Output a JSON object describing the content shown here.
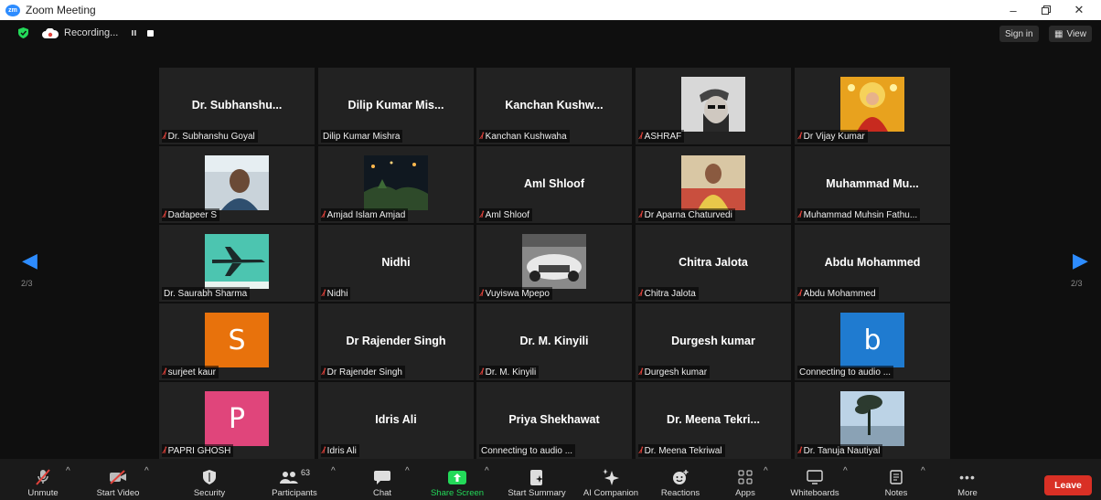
{
  "window": {
    "title": "Zoom Meeting",
    "logo": "zm"
  },
  "topbar": {
    "recording_label": "Recording...",
    "signin_label": "Sign in",
    "view_label": "View"
  },
  "pager": {
    "left_label": "2/3",
    "right_label": "2/3"
  },
  "tiles": [
    {
      "big": "Dr. Subhanshu...",
      "name": "Dr. Subhanshu Goyal",
      "muted": true
    },
    {
      "big": "Dilip Kumar Mis...",
      "name": "Dilip Kumar Mishra",
      "muted": false
    },
    {
      "big": "Kanchan Kushw...",
      "name": "Kanchan Kushwaha",
      "muted": true
    },
    {
      "big": "",
      "name": "ASHRAF",
      "muted": true
    },
    {
      "big": "",
      "name": "Dr Vijay Kumar",
      "muted": true
    },
    {
      "big": "",
      "name": "Dadapeer S",
      "muted": true
    },
    {
      "big": "",
      "name": "Amjad Islam Amjad",
      "muted": true
    },
    {
      "big": "Aml Shloof",
      "name": "Aml Shloof",
      "muted": true
    },
    {
      "big": "",
      "name": "Dr Aparna Chaturvedi",
      "muted": true
    },
    {
      "big": "Muhammad Mu...",
      "name": "Muhammad Muhsin Fathu...",
      "muted": true
    },
    {
      "big": "",
      "name": "Dr. Saurabh Sharma",
      "muted": false
    },
    {
      "big": "Nidhi",
      "name": "Nidhi",
      "muted": true
    },
    {
      "big": "",
      "name": "Vuyiswa Mpepo",
      "muted": true
    },
    {
      "big": "Chitra Jalota",
      "name": "Chitra Jalota",
      "muted": true
    },
    {
      "big": "Abdu Mohammed",
      "name": "Abdu Mohammed",
      "muted": true
    },
    {
      "big": "",
      "letter": "S",
      "letter_color": "#e8720c",
      "name": "surjeet kaur",
      "muted": true
    },
    {
      "big": "Dr Rajender Singh",
      "name": "Dr Rajender Singh",
      "muted": true
    },
    {
      "big": "Dr. M. Kinyili",
      "name": "Dr. M. Kinyili",
      "muted": true
    },
    {
      "big": "Durgesh kumar",
      "name": "Durgesh kumar",
      "muted": true
    },
    {
      "big": "",
      "letter": "b",
      "letter_color": "#1f7bd0",
      "name": "Connecting to audio ...",
      "muted": false
    },
    {
      "big": "",
      "letter": "P",
      "letter_color": "#e0457b",
      "name": "PAPRI GHOSH",
      "muted": true
    },
    {
      "big": "Idris Ali",
      "name": "Idris Ali",
      "muted": true
    },
    {
      "big": "Priya Shekhawat",
      "name": "Connecting to audio ...",
      "muted": false
    },
    {
      "big": "Dr. Meena Tekri...",
      "name": "Dr. Meena Tekriwal",
      "muted": true
    },
    {
      "big": "",
      "name": "Dr. Tanuja Nautiyal",
      "muted": true
    }
  ],
  "toolbar": {
    "unmute": "Unmute",
    "start_video": "Start Video",
    "security": "Security",
    "participants": "Participants",
    "participants_count": "63",
    "chat": "Chat",
    "share_screen": "Share Screen",
    "start_summary": "Start Summary",
    "ai_companion": "AI Companion",
    "reactions": "Reactions",
    "apps": "Apps",
    "whiteboards": "Whiteboards",
    "notes": "Notes",
    "more": "More",
    "leave": "Leave"
  },
  "colors": {
    "accent": "#2d8cff",
    "share_green": "#23d959",
    "leave_red": "#d93025",
    "muted_red": "#e0423b"
  }
}
